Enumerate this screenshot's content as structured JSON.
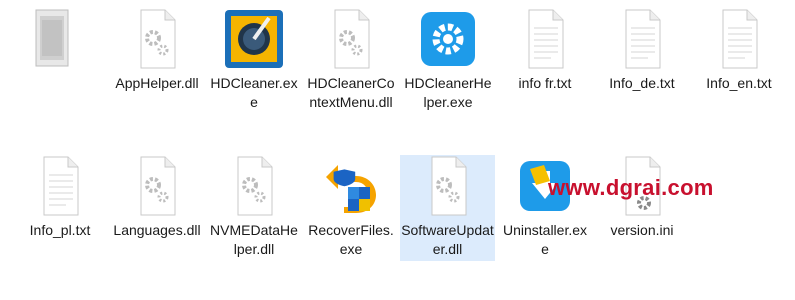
{
  "files": [
    {
      "name": "",
      "icon": "generic-file-icon"
    },
    {
      "name": "AppHelper.dll",
      "icon": "dll-gear-icon"
    },
    {
      "name": "HDCleaner.exe",
      "icon": "hdcleaner-app-icon"
    },
    {
      "name": "HDCleanerContextMenu.dll",
      "icon": "dll-gear-icon"
    },
    {
      "name": "HDCleanerHelper.exe",
      "icon": "blue-gear-app-icon"
    },
    {
      "name": "info fr.txt",
      "icon": "text-file-icon"
    },
    {
      "name": "Info_de.txt",
      "icon": "text-file-icon"
    },
    {
      "name": "Info_en.txt",
      "icon": "text-file-icon"
    },
    {
      "name": "Info_pl.txt",
      "icon": "text-file-icon"
    },
    {
      "name": "Languages.dll",
      "icon": "dll-gear-icon"
    },
    {
      "name": "NVMEDataHelper.dll",
      "icon": "dll-gear-icon"
    },
    {
      "name": "RecoverFiles.exe",
      "icon": "recover-app-icon"
    },
    {
      "name": "SoftwareUpdater.dll",
      "icon": "dll-gear-icon"
    },
    {
      "name": "Uninstaller.exe",
      "icon": "uninstaller-app-icon"
    },
    {
      "name": "version.ini",
      "icon": "ini-gear-icon"
    }
  ],
  "watermark": "www.dgrai.com",
  "colors": {
    "selection": "#dcebfc",
    "watermark": "#c8102e",
    "app_blue": "#1e9be9"
  }
}
